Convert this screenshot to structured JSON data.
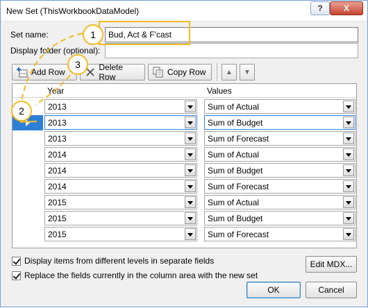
{
  "window": {
    "title": "New Set (ThisWorkbookDataModel)",
    "help_label": "?",
    "close_label": "X"
  },
  "form": {
    "set_name_label": "Set name:",
    "set_name_value": "Bud, Act & F'cast",
    "display_folder_label": "Display folder (optional):",
    "display_folder_value": ""
  },
  "toolbar": {
    "add_row": "Add Row",
    "delete_row": "Delete Row",
    "copy_row": "Copy Row",
    "move_up_icon": "up-arrow-icon",
    "move_down_icon": "down-arrow-icon"
  },
  "grid": {
    "columns": [
      "Year",
      "Values"
    ],
    "selected_row": 1,
    "rows": [
      {
        "year": "2013",
        "value": "Sum of Actual"
      },
      {
        "year": "2013",
        "value": "Sum of Budget"
      },
      {
        "year": "2013",
        "value": "Sum of Forecast"
      },
      {
        "year": "2014",
        "value": "Sum of Actual"
      },
      {
        "year": "2014",
        "value": "Sum of Budget"
      },
      {
        "year": "2014",
        "value": "Sum of Forecast"
      },
      {
        "year": "2015",
        "value": "Sum of Actual"
      },
      {
        "year": "2015",
        "value": "Sum of Budget"
      },
      {
        "year": "2015",
        "value": "Sum of Forecast"
      }
    ]
  },
  "options": {
    "separate_fields_label": "Display items from different levels in separate fields",
    "separate_fields_checked": true,
    "replace_fields_label": "Replace the fields currently in the column area with the new set",
    "replace_fields_checked": true
  },
  "buttons": {
    "edit_mdx": "Edit MDX...",
    "ok": "OK",
    "cancel": "Cancel"
  },
  "callouts": [
    "1",
    "2",
    "3"
  ],
  "colors": {
    "callout": "#f5b922",
    "selection": "#2e7fd6"
  }
}
